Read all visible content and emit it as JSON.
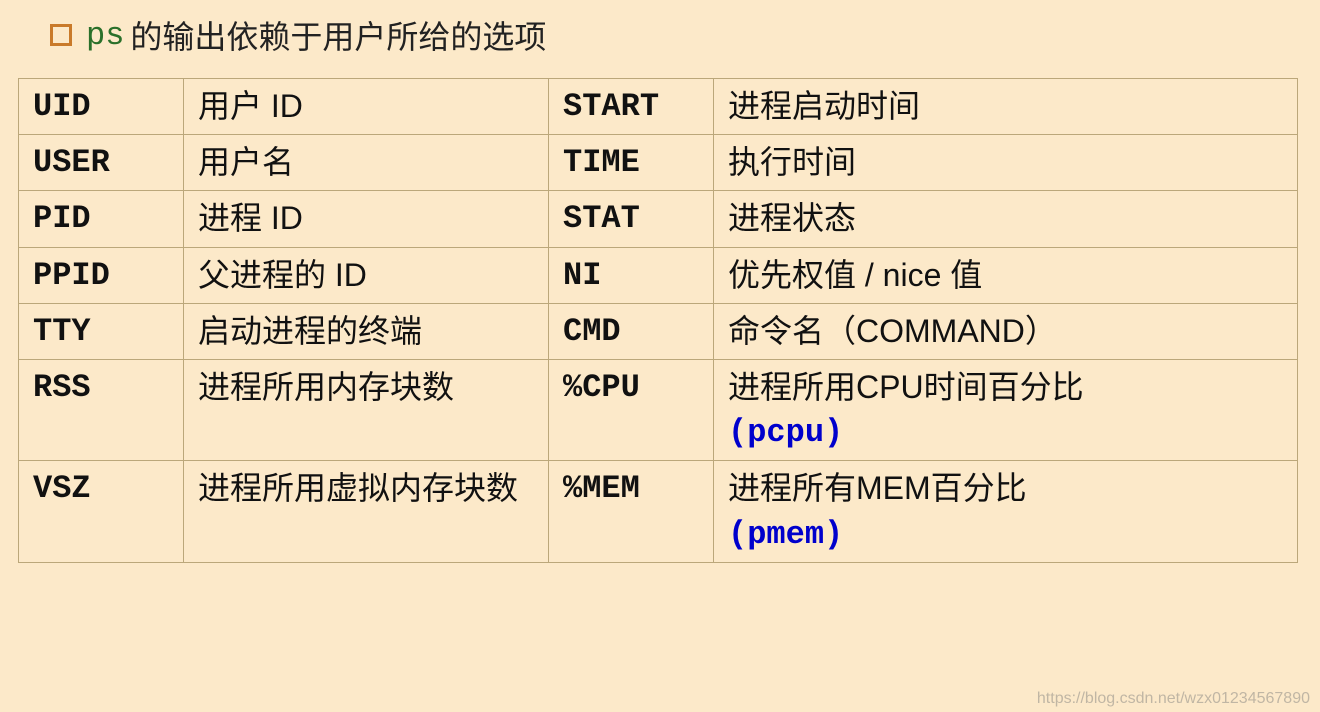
{
  "header": {
    "code": "ps",
    "text": "的输出依赖于用户所给的选项"
  },
  "rows": [
    {
      "k1": "UID",
      "d1": "用户 ID",
      "k2": "START",
      "d2": "进程启动时间"
    },
    {
      "k1": "USER",
      "d1": "用户名",
      "k2": "TIME",
      "d2": "执行时间"
    },
    {
      "k1": "PID",
      "d1": "进程 ID",
      "k2": "STAT",
      "d2": "进程状态"
    },
    {
      "k1": "PPID",
      "d1": "父进程的 ID",
      "k2": "NI",
      "d2": "优先权值 / nice 值"
    },
    {
      "k1": "TTY",
      "d1": "启动进程的终端",
      "k2": "CMD",
      "d2": "命令名（COMMAND）"
    },
    {
      "k1": "RSS",
      "d1": "进程所用内存块数",
      "k2": "%CPU",
      "d2": "进程所用CPU时间百分比",
      "d2sub": "(pcpu)"
    },
    {
      "k1": "VSZ",
      "d1": "进程所用虚拟内存块数",
      "k2": "%MEM",
      "d2": "进程所有MEM百分比",
      "d2sub": "(pmem)"
    }
  ],
  "watermark": "https://blog.csdn.net/wzx01234567890"
}
